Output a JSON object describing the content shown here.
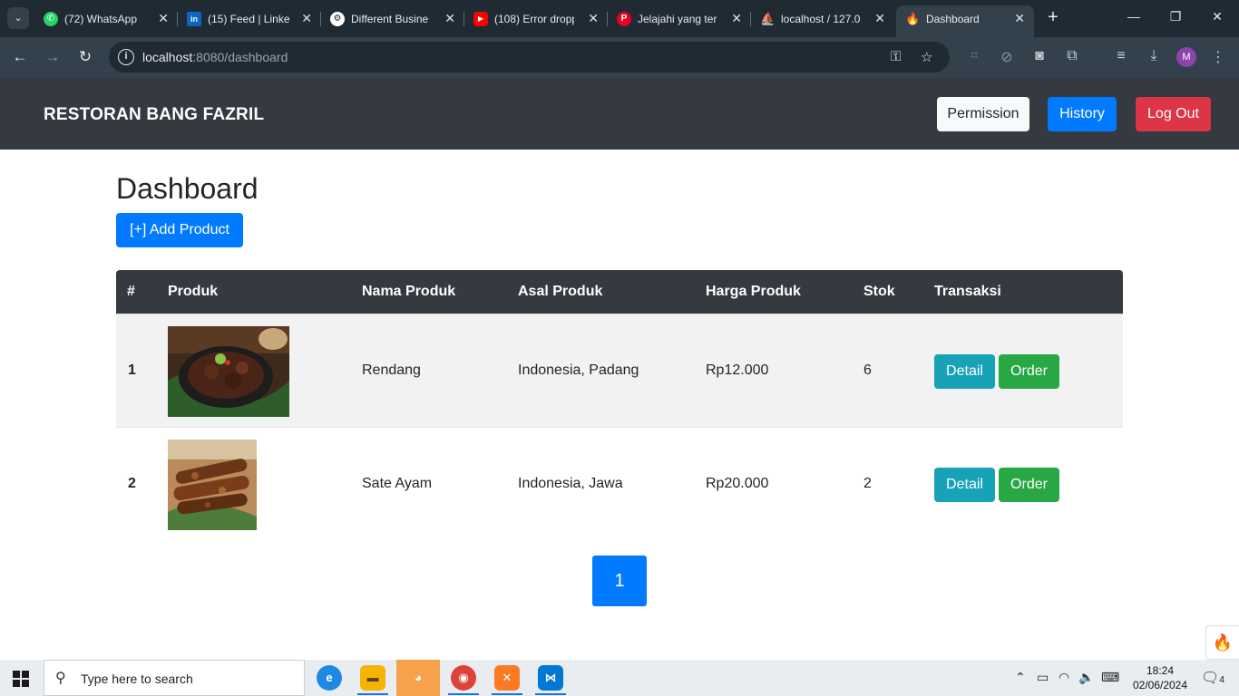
{
  "browser": {
    "tabs": [
      {
        "label": "(72) WhatsApp",
        "icon": "whatsapp-icon",
        "color": "#25d366"
      },
      {
        "label": "(15) Feed | Linke",
        "icon": "linkedin-icon",
        "color": "#0a66c2"
      },
      {
        "label": "Different Busine",
        "icon": "chatgpt-icon",
        "color": "#ffffff"
      },
      {
        "label": "(108) Error dropp",
        "icon": "youtube-icon",
        "color": "#ff0000"
      },
      {
        "label": "Jelajahi yang ter",
        "icon": "pinterest-icon",
        "color": "#e60023"
      },
      {
        "label": "localhost / 127.0",
        "icon": "phpmyadmin-icon",
        "color": "#f29111"
      },
      {
        "label": "Dashboard",
        "icon": "codeigniter-icon",
        "color": "#e8532c"
      }
    ],
    "address": {
      "host": "localhost",
      "path": ":8080/dashboard"
    }
  },
  "app": {
    "brand": "RESTORAN BANG FAZRIL",
    "nav": {
      "permission": "Permission",
      "history": "History",
      "logout": "Log Out"
    },
    "title": "Dashboard",
    "add_button": "[+] Add Product",
    "table": {
      "headers": [
        "#",
        "Produk",
        "Nama Produk",
        "Asal Produk",
        "Harga Produk",
        "Stok",
        "Transaksi"
      ],
      "rows": [
        {
          "no": "1",
          "image": "rendang-image",
          "name": "Rendang",
          "origin": "Indonesia, Padang",
          "price": "Rp12.000",
          "stock": "6",
          "detail": "Detail",
          "order": "Order"
        },
        {
          "no": "2",
          "image": "sate-ayam-image",
          "name": "Sate Ayam",
          "origin": "Indonesia, Jawa",
          "price": "Rp20.000",
          "stock": "2",
          "detail": "Detail",
          "order": "Order"
        }
      ]
    },
    "pagination": {
      "current": "1"
    }
  },
  "taskbar": {
    "search_placeholder": "Type here to search",
    "time": "18:24",
    "date": "02/06/2024",
    "notifications": "4"
  }
}
